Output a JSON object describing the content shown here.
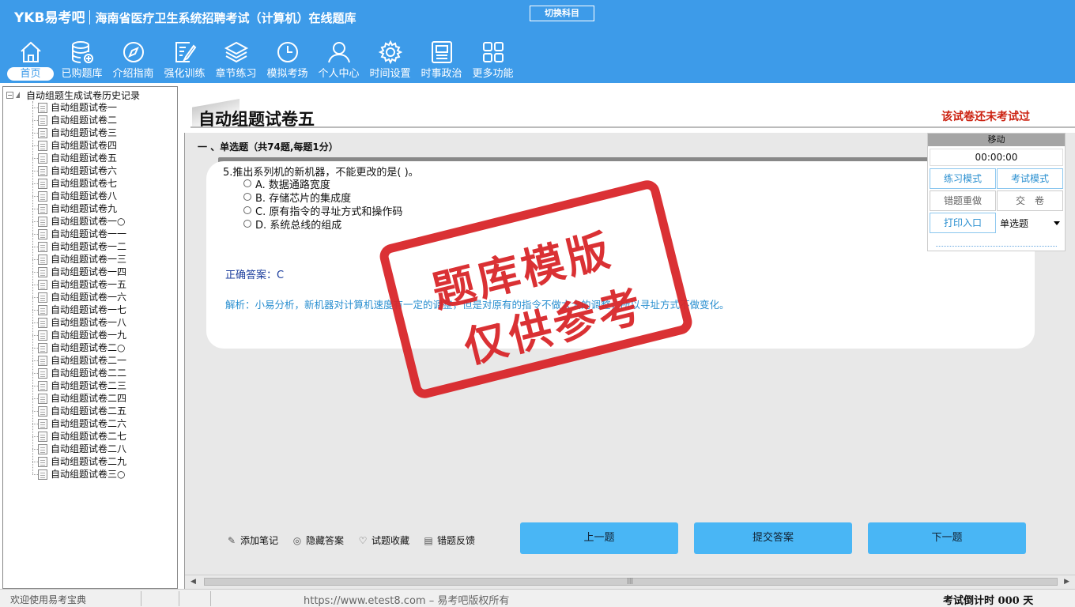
{
  "header": {
    "brand": "YKB易考吧",
    "title": "海南省医疗卫生系统招聘考试（计算机）在线题库",
    "switch_label": "切换科目"
  },
  "nav": [
    {
      "label": "首页",
      "icon": "home-icon",
      "active": true
    },
    {
      "label": "已购题库",
      "icon": "database-icon"
    },
    {
      "label": "介绍指南",
      "icon": "compass-icon"
    },
    {
      "label": "强化训练",
      "icon": "edit-icon"
    },
    {
      "label": "章节练习",
      "icon": "layers-icon"
    },
    {
      "label": "模拟考场",
      "icon": "clock-icon"
    },
    {
      "label": "个人中心",
      "icon": "user-icon"
    },
    {
      "label": "时间设置",
      "icon": "gear-icon"
    },
    {
      "label": "时事政治",
      "icon": "news-icon"
    },
    {
      "label": "更多功能",
      "icon": "grid-icon"
    }
  ],
  "tree": {
    "root_label": "自动组题生成试卷历史记录",
    "items": [
      "自动组题试卷一",
      "自动组题试卷二",
      "自动组题试卷三",
      "自动组题试卷四",
      "自动组题试卷五",
      "自动组题试卷六",
      "自动组题试卷七",
      "自动组题试卷八",
      "自动组题试卷九",
      "自动组题试卷一○",
      "自动组题试卷一一",
      "自动组题试卷一二",
      "自动组题试卷一三",
      "自动组题试卷一四",
      "自动组题试卷一五",
      "自动组题试卷一六",
      "自动组题试卷一七",
      "自动组题试卷一八",
      "自动组题试卷一九",
      "自动组题试卷二○",
      "自动组题试卷二一",
      "自动组题试卷二二",
      "自动组题试卷二三",
      "自动组题试卷二四",
      "自动组题试卷二五",
      "自动组题试卷二六",
      "自动组题试卷二七",
      "自动组题试卷二八",
      "自动组题试卷二九",
      "自动组题试卷三○"
    ]
  },
  "paper": {
    "title": "自动组题试卷五",
    "status": "该试卷还未考试过",
    "section": "一 、单选题（共74题,每题1分）"
  },
  "question": {
    "text": "5.推出系列机的新机器，不能更改的是( )。",
    "options": [
      "A. 数据通路宽度",
      "B. 存储芯片的集成度",
      "C. 原有指令的寻址方式和操作码",
      "D. 系统总线的组成"
    ],
    "answer": "正确答案：C",
    "analysis": "解析：小易分析，新机器对计算机速度有一定的调整，但是对原有的指令不做太大的调整，所以寻址方式不做变化。"
  },
  "stamp": {
    "line1": "题库模版",
    "line2": "仅供参考"
  },
  "tools": [
    {
      "label": "添加笔记",
      "icon": "pencil-icon"
    },
    {
      "label": "隐藏答案",
      "icon": "eye-icon"
    },
    {
      "label": "试题收藏",
      "icon": "heart-icon"
    },
    {
      "label": "错题反馈",
      "icon": "feedback-icon"
    }
  ],
  "buttons": {
    "prev": "上一题",
    "submit": "提交答案",
    "next": "下一题"
  },
  "panel": {
    "head": "移动",
    "timer": "00:00:00",
    "practice_mode": "练习模式",
    "exam_mode": "考试模式",
    "redo_wrong": "错题重做",
    "submit_paper": "交　卷",
    "print": "打印入口",
    "question_type": "单选题"
  },
  "status": {
    "welcome": "欢迎使用易考宝典",
    "copyright": "https://www.etest8.com – 易考吧版权所有",
    "countdown": "考试倒计时 000 天"
  },
  "colors": {
    "header": "#3d9be9",
    "button": "#49b6f5",
    "stamp": "#d9262a",
    "analysis": "#2a8fd0",
    "warning": "#c21"
  }
}
